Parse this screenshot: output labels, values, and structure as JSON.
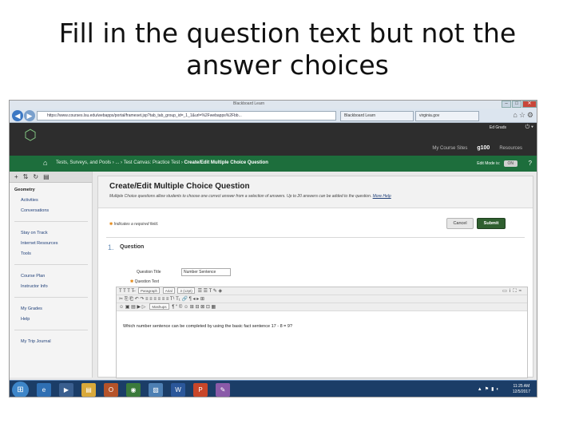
{
  "slide": {
    "title_line1": "Fill in the question text but not the",
    "title_line2": "answer choices"
  },
  "browser": {
    "window_title": "Blackboard Learn",
    "url": "https://www.courses.lsu.edu/webapps/portal/frameset.jsp?tab_tab_group_id=_1_1&url=%2Fwebapps%2Fbb...",
    "tabs": [
      "Blackboard Learn",
      "virginia.gov"
    ]
  },
  "header": {
    "user": "Ed Grads",
    "links": [
      "My Course Sites",
      "g100",
      "Resources"
    ]
  },
  "breadcrumb": {
    "path": "Tests, Surveys, and Pools  ›  ...  ›  Test Canvas: Practice Test  ›",
    "current": "Create/Edit Multiple Choice Question",
    "edit_mode_label": "Edit Mode is:",
    "edit_mode_value": "ON"
  },
  "menu": {
    "course": "Geometry",
    "items": [
      "Activities",
      "Conversations",
      "Stay on Track",
      "Internet Resources",
      "Tools",
      "Course Plan",
      "Instructor Info",
      "My Grades",
      "Help",
      "My Trip Journal"
    ]
  },
  "page": {
    "title": "Create/Edit Multiple Choice Question",
    "description": "Multiple Choice questions allow students to choose one correct answer from a selection of answers. Up to 20 answers can be added to the question.",
    "more_help": "More Help",
    "required_note": "Indicates a required field.",
    "cancel_label": "Cancel",
    "submit_label": "Submit",
    "section_number": "1.",
    "section_title": "Question",
    "question_title_label": "Question Title",
    "question_title_value": "Number Sentence",
    "question_text_label": "Question Text",
    "editor": {
      "paragraph": "Paragraph",
      "font": "Arial",
      "size": "3 (12pt)",
      "mashups": "Mashups",
      "text": "Which number sentence can be completed by using the basic fact sentence 17 - 8 = 9?"
    }
  },
  "taskbar": {
    "time": "11:25 AM",
    "date": "12/5/2017"
  }
}
